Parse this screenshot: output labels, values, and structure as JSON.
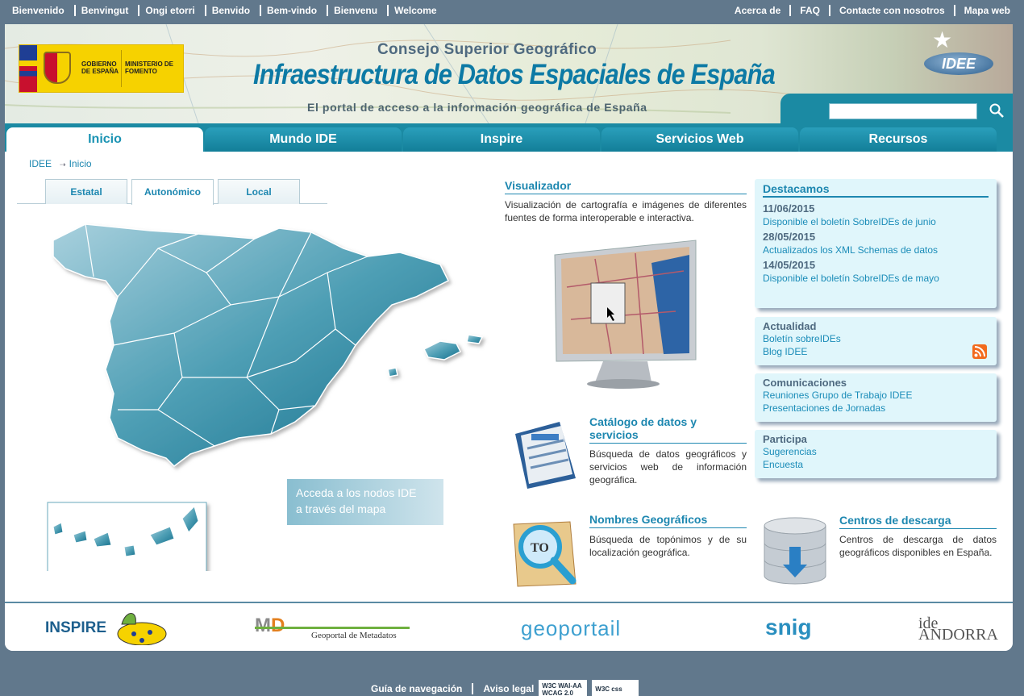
{
  "top_nav": {
    "languages": [
      "Bienvenido",
      "Benvingut",
      "Ongi etorri",
      "Benvido",
      "Bem-vindo",
      "Bienvenu",
      "Welcome"
    ],
    "utility": [
      "Acerca de",
      "FAQ",
      "Contacte con nosotros",
      "Mapa web"
    ]
  },
  "header": {
    "gov_left": "GOBIERNO DE ESPAÑA",
    "gov_right": "MINISTERIO DE FOMENTO",
    "council": "Consejo Superior Geográfico",
    "title": "Infraestructura de Datos Espaciales de España",
    "subtitle": "El portal de acceso a la información geográfica de España",
    "logo": "IDEE",
    "search_value": ""
  },
  "tabs": [
    "Inicio",
    "Mundo IDE",
    "Inspire",
    "Servicios Web",
    "Recursos"
  ],
  "active_tab": "Inicio",
  "breadcrumb": {
    "root": "IDEE",
    "current": "Inicio"
  },
  "subtabs": [
    "Estatal",
    "Autonómico",
    "Local"
  ],
  "active_subtab": "Autonómico",
  "map_button": {
    "line1": "Acceda a los nodos IDE",
    "line2": "a través del mapa"
  },
  "visualizador": {
    "title": "Visualizador",
    "desc": "Visualización de cartografía e imágenes de diferentes fuentes de forma interoperable e interactiva."
  },
  "catalogo": {
    "title": "Catálogo de datos y servicios",
    "desc": "Búsqueda de datos geográficos y servicios web de información geográfica."
  },
  "nombres": {
    "title": "Nombres Geográficos",
    "desc": "Búsqueda de topónimos y de su localización geográfica."
  },
  "centros": {
    "title": "Centros de descarga",
    "desc": "Centros de descarga de datos geográficos disponibles en España."
  },
  "destacamos": {
    "title": "Destacamos",
    "items": [
      {
        "date": "11/06/2015",
        "text": "Disponible el boletín SobreIDEs de junio"
      },
      {
        "date": "28/05/2015",
        "text": "Actualizados los XML Schemas de datos"
      },
      {
        "date": "14/05/2015",
        "text": "Disponible el boletín SobreIDEs de mayo"
      }
    ]
  },
  "actualidad": {
    "title": "Actualidad",
    "links": [
      "Boletín sobreIDEs",
      "Blog IDEE"
    ]
  },
  "comunicaciones": {
    "title": "Comunicaciones",
    "links": [
      "Reuniones Grupo de Trabajo IDEE",
      "Presentaciones de Jornadas"
    ]
  },
  "participa": {
    "title": "Participa",
    "links": [
      "Sugerencias",
      "Encuesta"
    ]
  },
  "footer_logos": {
    "inspire": "INSPIRE",
    "metadatos": "Geoportal de Metadatos",
    "geoportail": "geoportail",
    "snig": "snig",
    "ide_andorra": "ide ANDORRA"
  },
  "bottom": {
    "guide": "Guía de navegación",
    "legal": "Aviso legal",
    "w3c_wai": "W3C WAI-AA WCAG 2.0",
    "w3c_css": "W3C css"
  },
  "colors": {
    "accent": "#1a93b3",
    "teal": "#1b8aa3",
    "page_bg": "#61788c",
    "box_bg": "#e0f6fb"
  }
}
